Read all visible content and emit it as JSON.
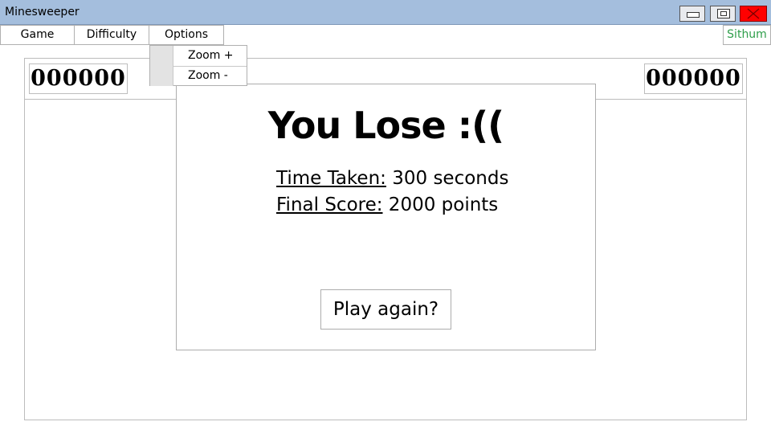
{
  "window": {
    "title": "Minesweeper",
    "controls": {
      "minimize": "minimize-icon",
      "maximize": "maximize-icon",
      "close": "close-icon"
    },
    "close_color": "#ff0000"
  },
  "menu": {
    "items": [
      {
        "label": "Game"
      },
      {
        "label": "Difficulty"
      },
      {
        "label": "Options"
      }
    ],
    "user": "Sithum"
  },
  "options_menu": {
    "items": [
      {
        "label": "Zoom +"
      },
      {
        "label": "Zoom -"
      }
    ]
  },
  "board": {
    "left_counter": "000000",
    "right_counter": "000000"
  },
  "dialog": {
    "title": "You Lose :((",
    "time_label": "Time Taken:",
    "time_value": " 300 seconds",
    "score_label": "Final Score:",
    "score_value": " 2000 points",
    "button": "Play again?"
  },
  "colors": {
    "titlebar": "#a4bedd",
    "user_text": "#2e9e4a"
  }
}
